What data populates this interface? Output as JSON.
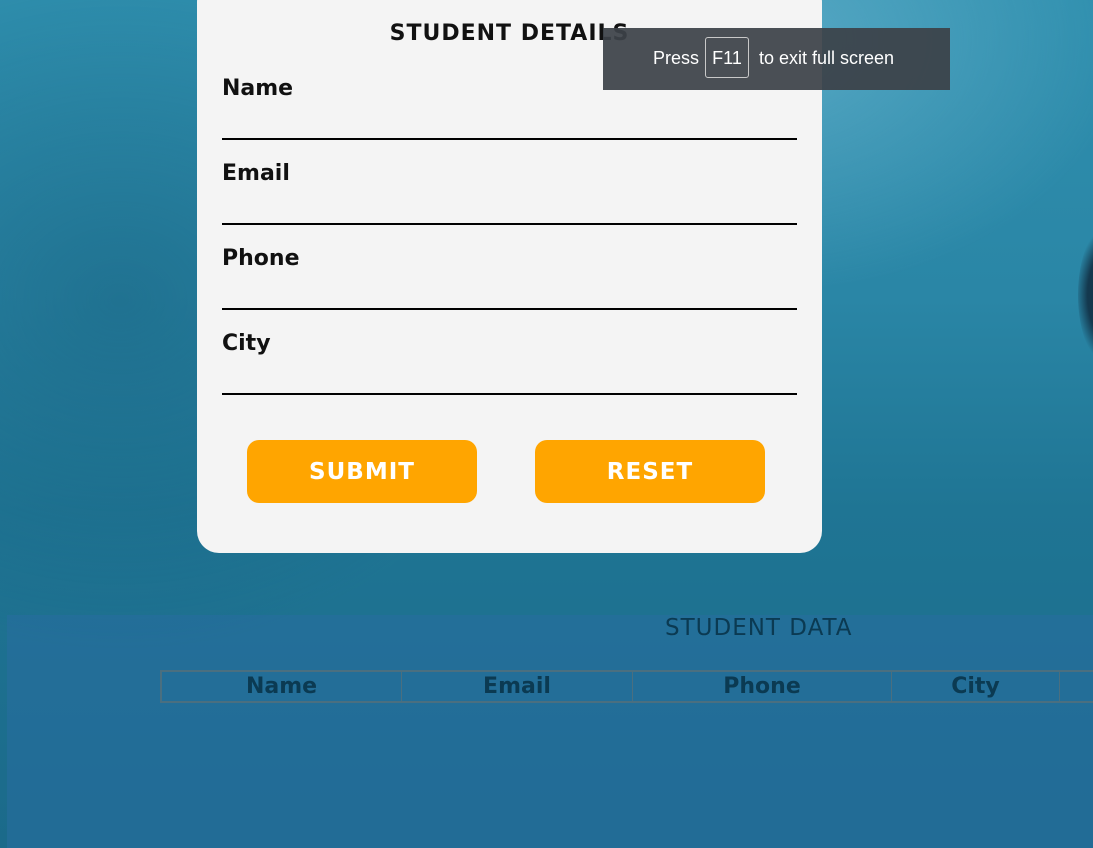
{
  "form": {
    "title": "STUDENT DETAILS",
    "fields": [
      {
        "label": "Name",
        "value": ""
      },
      {
        "label": "Email",
        "value": ""
      },
      {
        "label": "Phone",
        "value": ""
      },
      {
        "label": "City",
        "value": ""
      }
    ],
    "submit_label": "SUBMIT",
    "reset_label": "RESET"
  },
  "fullscreen_toast": {
    "press": "Press",
    "key": "F11",
    "rest": "to exit full screen"
  },
  "data_panel": {
    "title": "STUDENT DATA",
    "columns": [
      "Name",
      "Email",
      "Phone",
      "City",
      ""
    ]
  },
  "colors": {
    "button": "#ffa500",
    "card": "#f4f4f4",
    "background": "#2a86a6",
    "panel_text": "#0b3a52"
  }
}
